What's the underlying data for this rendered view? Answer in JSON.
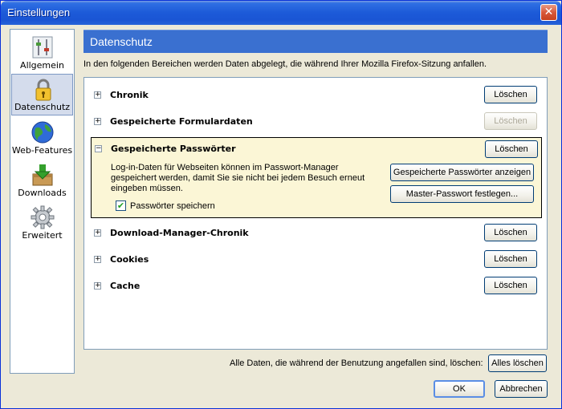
{
  "window": {
    "title": "Einstellungen"
  },
  "nav": {
    "items": [
      {
        "label": "Allgemein",
        "icon": "sliders-icon"
      },
      {
        "label": "Datenschutz",
        "icon": "padlock-icon"
      },
      {
        "label": "Web-Features",
        "icon": "globe-icon"
      },
      {
        "label": "Downloads",
        "icon": "download-box-icon"
      },
      {
        "label": "Erweitert",
        "icon": "gear-icon"
      }
    ],
    "selected": "Datenschutz"
  },
  "header": {
    "title": "Datenschutz"
  },
  "description": "In den folgenden Bereichen werden Daten abgelegt, die während Ihrer Mozilla Firefox-Sitzung anfallen.",
  "sections": [
    {
      "label": "Chronik",
      "button": "Löschen",
      "enabled": true,
      "expanded": false
    },
    {
      "label": "Gespeicherte Formulardaten",
      "button": "Löschen",
      "enabled": false,
      "expanded": false
    },
    {
      "label": "Gespeicherte Passwörter",
      "button": "Löschen",
      "enabled": true,
      "expanded": true,
      "details": "Log-in-Daten für Webseiten können im Passwort-Manager gespeichert werden, damit Sie sie nicht bei jedem Besuch erneut eingeben müssen.",
      "show_button": "Gespeicherte Passwörter anzeigen",
      "master_button": "Master-Passwort festlegen...",
      "checkbox_label": "Passwörter speichern",
      "checkbox_checked": true
    },
    {
      "label": "Download-Manager-Chronik",
      "button": "Löschen",
      "enabled": true,
      "expanded": false
    },
    {
      "label": "Cookies",
      "button": "Löschen",
      "enabled": true,
      "expanded": false
    },
    {
      "label": "Cache",
      "button": "Löschen",
      "enabled": true,
      "expanded": false
    }
  ],
  "footer": {
    "clear_all_text": "Alle Daten, die während der Benutzung angefallen sind, löschen:",
    "clear_all_button": "Alles löschen",
    "ok_button": "OK",
    "cancel_button": "Abbrechen"
  },
  "symbols": {
    "expand": "+",
    "collapse": "−",
    "close": "✕",
    "check": "✔"
  },
  "colors": {
    "header_bg": "#3a70d0",
    "expanded_bg": "#fbf6d6",
    "selected_nav_bg": "#d4dcec"
  }
}
